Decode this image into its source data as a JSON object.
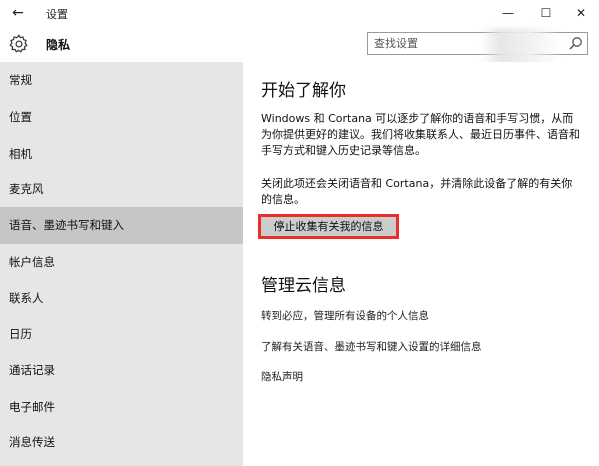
{
  "window": {
    "back_icon": "←",
    "title": "设置",
    "minimize_icon": "—",
    "maximize_icon": "☐",
    "close_icon": "✕"
  },
  "header": {
    "title": "隐私",
    "search_placeholder": "查找设置"
  },
  "sidebar": {
    "items": [
      {
        "label": "常规"
      },
      {
        "label": "位置"
      },
      {
        "label": "相机"
      },
      {
        "label": "麦克风"
      },
      {
        "label": "语音、墨迹书写和键入",
        "selected": true
      },
      {
        "label": "帐户信息"
      },
      {
        "label": "联系人"
      },
      {
        "label": "日历"
      },
      {
        "label": "通话记录"
      },
      {
        "label": "电子邮件"
      },
      {
        "label": "消息传送"
      }
    ]
  },
  "main": {
    "section1": {
      "title": "开始了解你",
      "description": "Windows 和 Cortana 可以逐步了解你的语音和手写习惯，从而为你提供更好的建议。我们将收集联系人、最近日历事件、语音和手写方式和键入历史记录等信息。",
      "note": "关闭此项还会关闭语音和 Cortana，并清除此设备了解的有关你的信息。",
      "button_label": "停止收集有关我的信息"
    },
    "section2": {
      "title": "管理云信息",
      "links": [
        "转到必应，管理所有设备的个人信息",
        "了解有关语音、墨迹书写和键入设置的详细信息",
        "隐私声明"
      ]
    }
  },
  "colors": {
    "sidebar_bg": "#e6e6e6",
    "selected_bg": "#c6c6c6",
    "highlight_border": "#e8302a",
    "button_bg": "#cccccc"
  }
}
